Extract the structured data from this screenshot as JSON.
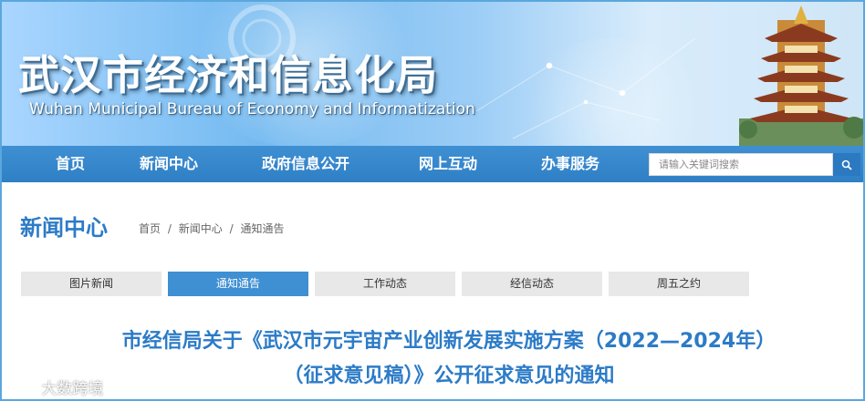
{
  "header": {
    "title": "武汉市经济和信息化局",
    "subtitle": "Wuhan Municipal Bureau of Economy and Informatization"
  },
  "nav": {
    "items": [
      "首页",
      "新闻中心",
      "政府信息公开",
      "网上互动",
      "办事服务"
    ],
    "search_placeholder": "请输入关键词搜索"
  },
  "section": {
    "title": "新闻中心",
    "breadcrumb": [
      "首页",
      "新闻中心",
      "通知通告"
    ],
    "separator": "/"
  },
  "tabs": [
    {
      "label": "图片新闻",
      "active": false
    },
    {
      "label": "通知通告",
      "active": true
    },
    {
      "label": "工作动态",
      "active": false
    },
    {
      "label": "经信动态",
      "active": false
    },
    {
      "label": "周五之约",
      "active": false
    }
  ],
  "article": {
    "title_line1": "市经信局关于《武汉市元宇宙产业创新发展实施方案（2022—2024年）",
    "title_line2": "（征求意见稿）》公开征求意见的通知"
  },
  "watermark": {
    "text": "大数跨境"
  },
  "colors": {
    "accent": "#2c7bc7",
    "nav": "#3f8fd3",
    "border": "#5aa7dd"
  },
  "icons": {
    "search": "search-icon",
    "tower": "yellow-crane-tower-icon",
    "watermark_logo": "watermark-logo-icon"
  }
}
